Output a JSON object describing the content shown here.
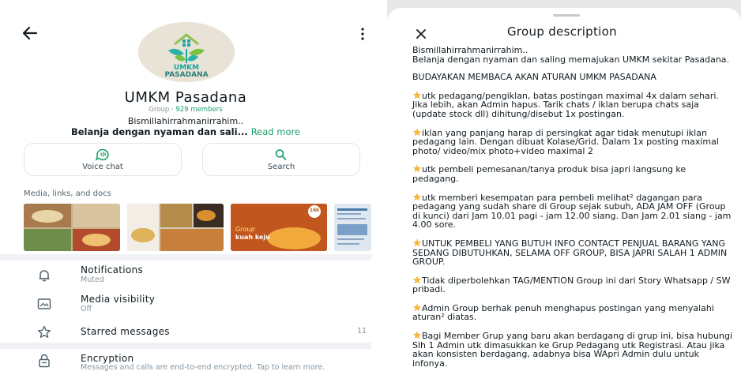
{
  "left": {
    "group_name": "UMKM Pasadana",
    "group_type": "Group · ",
    "members": "929 members",
    "logo_line1": "UMKM",
    "logo_line2": "PASADANA",
    "description_line1": "Bismillahirrahmanirrahim..",
    "description_line2": "Belanja dengan nyaman dan sali...",
    "read_more": "Read more",
    "actions": [
      {
        "label": "Voice chat",
        "icon": "voice-chat-icon"
      },
      {
        "label": "Search",
        "icon": "search-icon"
      }
    ],
    "media_section_title": "Media, links, and docs",
    "thumb_text": {
      "t3_line1": "Group",
      "t3_line2": "kuah keju",
      "t3_badge": "16k"
    },
    "rows": [
      {
        "title": "Notifications",
        "subtitle": "Muted",
        "icon": "bell-icon"
      },
      {
        "title": "Media visibility",
        "subtitle": "Off",
        "icon": "media-visibility-icon"
      },
      {
        "title": "Starred messages",
        "count": "11",
        "icon": "star-icon"
      },
      {
        "title": "Encryption",
        "subtitle": "Messages and calls are end-to-end encrypted. Tap to learn more.",
        "icon": "lock-icon"
      }
    ],
    "colors": {
      "accent": "#1aa06a",
      "muted": "#8696a0",
      "divider": "#f0f2f5"
    }
  },
  "right": {
    "title": "Group description",
    "paragraphs": [
      {
        "star": false,
        "text": "Bismillahirrahmanirrahim..\nBelanja dengan nyaman dan saling memajukan UMKM sekitar Pasadana."
      },
      {
        "star": false,
        "text": "BUDAYAKAN MEMBACA AKAN ATURAN UMKM PASADANA"
      },
      {
        "star": true,
        "text": "utk pedagang/pengiklan, batas postingan maximal 4x dalam sehari. Jika lebih, akan Admin hapus. Tarik chats / iklan berupa chats saja (update stock dll) dihitung/disebut 1x postingan."
      },
      {
        "star": true,
        "text": "iklan yang panjang harap di persingkat agar tidak menutupi iklan pedagang lain. Dengan dibuat Kolase/Grid. Dalam 1x posting maximal photo/ video/mix photo+video maximal 2"
      },
      {
        "star": true,
        "text": "utk pembeli pemesanan/tanya produk bisa japri langsung ke pedagang."
      },
      {
        "star": true,
        "text": "utk memberi kesempatan para pembeli melihat² dagangan para pedagang yang sudah share di Group sejak subuh, ADA JAM OFF (Group di kunci) dari Jam 10.01 pagi - jam 12.00 siang. Dan Jam 2.01 siang - jam 4.00 sore."
      },
      {
        "star": true,
        "text": "UNTUK PEMBELI YANG BUTUH INFO CONTACT PENJUAL BARANG YANG SEDANG DIBUTUHKAN, SELAMA OFF GROUP, BISA JAPRI SALAH 1 ADMIN GROUP."
      },
      {
        "star": true,
        "text": "Tidak diperbolehkan TAG/MENTION Group ini dari Story Whatsapp / SW pribadi."
      },
      {
        "star": true,
        "text": "Admin Group berhak penuh menghapus postingan yang menyalahi aturan² diatas."
      },
      {
        "star": true,
        "text": "Bagi Member Grup yang baru akan berdagang di grup ini, bisa hubungi Slh 1 Admin utk dimasukkan ke Grup Pedagang utk Registrasi. Atau jika akan konsisten berdagang, adabnya bisa WApri Admin dulu untuk infonya."
      }
    ],
    "colors": {
      "star": "#f5b83d",
      "backdrop": "#e8e8e8"
    }
  }
}
